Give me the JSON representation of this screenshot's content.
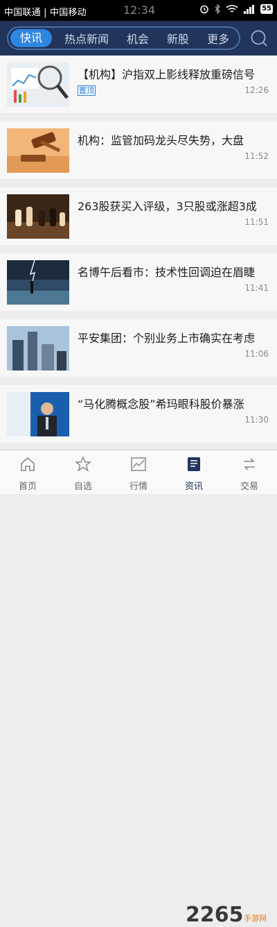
{
  "status_bar": {
    "carrier": "中国联通 | 中国移动",
    "time": "12:34",
    "battery": "55"
  },
  "tabs": [
    "快讯",
    "热点新闻",
    "机会",
    "新股",
    "更多"
  ],
  "news": [
    {
      "title": "【机构】沪指双上影线释放重磅信号",
      "time": "12:26",
      "pinned": "置顶"
    },
    {
      "title": "机构：监管加码龙头尽失势，大盘",
      "time": "11:52"
    },
    {
      "title": "263股获买入评级，3只股或涨超3成",
      "time": "11:51"
    },
    {
      "title": "名博午后看市：技术性回调迫在眉睫",
      "time": "11:41"
    },
    {
      "title": "平安集团：个别业务上市确实在考虑",
      "time": "11:06"
    },
    {
      "title": "“马化腾概念股”希玛眼科股价暴涨",
      "time": "11:30"
    }
  ],
  "bottom_nav": [
    "首页",
    "自选",
    "行情",
    "资讯",
    "交易"
  ],
  "watermark": {
    "brand": "2265",
    "sub": "手游网"
  }
}
